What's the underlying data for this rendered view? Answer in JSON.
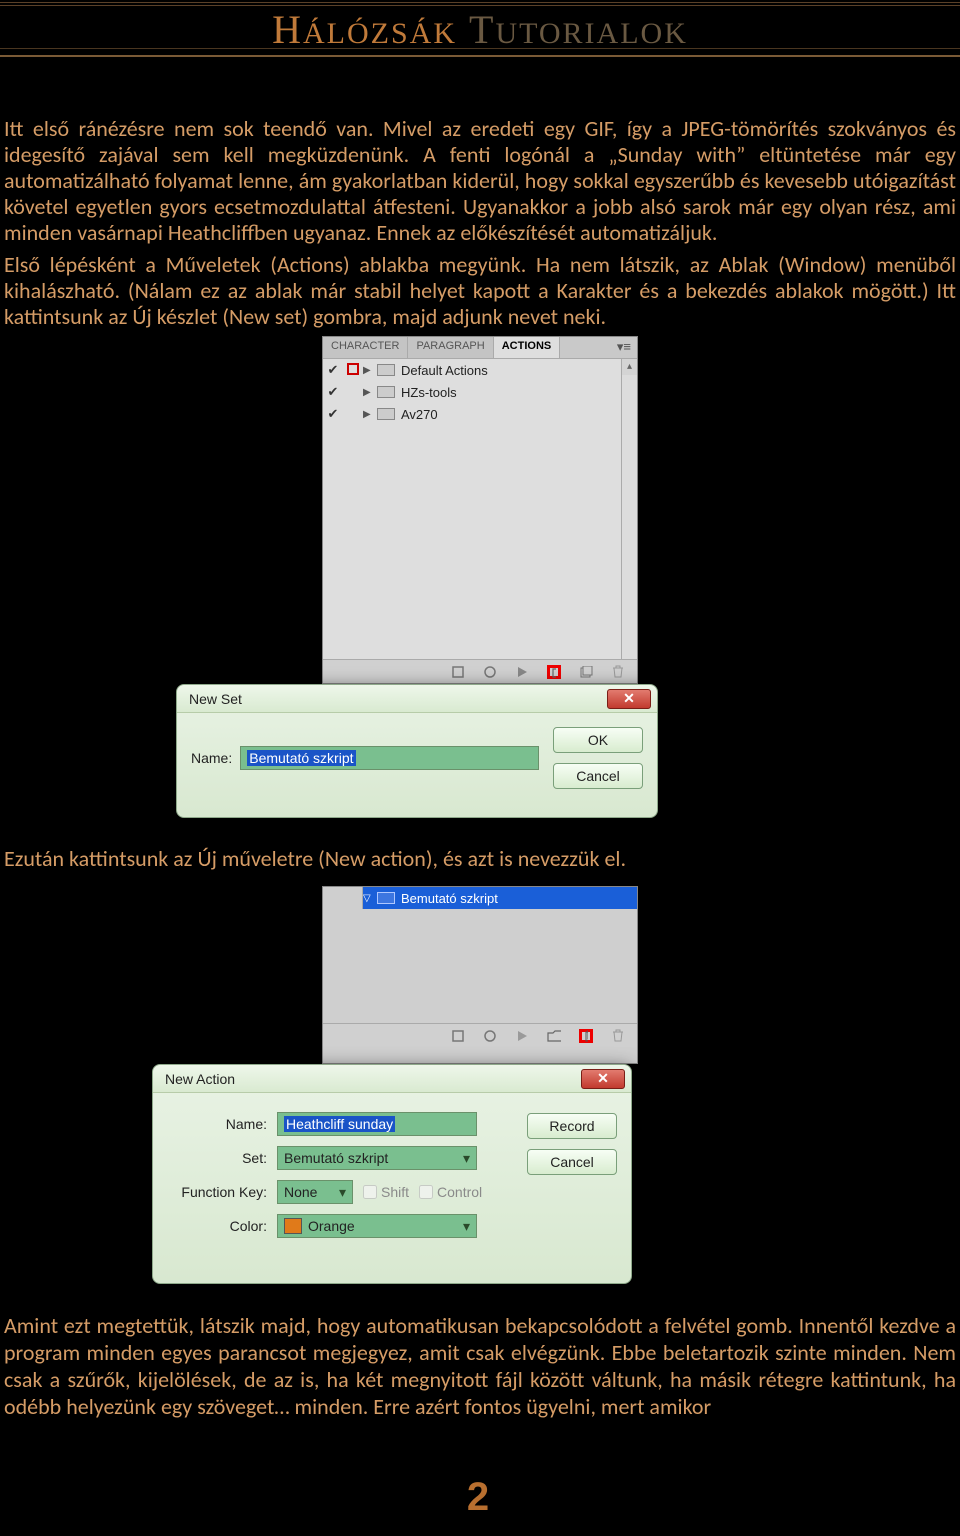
{
  "header": {
    "title_main_cap": "H",
    "title_main_rest": "ÁLÓZSÁK",
    "title_sub_cap": "T",
    "title_sub_rest": "UTORIALOK"
  },
  "paragraphs": {
    "p1": "Itt első ránézésre nem sok teendő van. Mivel az eredeti egy GIF, így a JPEG-tömörítés szokványos és idegesítő zajával sem kell megküzdenünk. A fenti logónál a „Sunday with” eltüntetése már egy automatizálható folyamat lenne, ám gyakorlatban kiderül, hogy sokkal egyszerűbb és kevesebb utóigazítást követel egyetlen gyors ecsetmozdulattal átfesteni. Ugyanakkor a jobb alsó sarok már egy olyan rész, ami minden vasárnapi Heathcliffben ugyanaz. Ennek az előkészítését automatizáljuk.",
    "p2": "Első lépésként a Műveletek (Actions) ablakba megyünk. Ha nem látszik, az Ablak (Window) menüből kihalászható. (Nálam ez az ablak már stabil helyet kapott a Karakter és a bekezdés ablakok mögött.) Itt kattintsunk az Új készlet (New set) gombra, majd adjunk nevet neki.",
    "p3": "Ezután kattintsunk az Új műveletre (New action), és azt is nevezzük el.",
    "p4": "Amint ezt megtettük, látszik majd, hogy automatikusan bekapcsolódott a felvétel gomb. Innentől kezdve a program minden egyes parancsot megjegyez, amit csak elvégzünk. Ebbe beletartozik szinte minden. Nem csak a szűrők, kijelölések, de az is, ha két megnyitott fájl között váltunk, ha másik rétegre kattintunk, ha odébb helyezünk egy szöveget… minden. Erre azért fontos ügyelni, mert amikor"
  },
  "actions_panel": {
    "tabs": [
      "CHARACTER",
      "PARAGRAPH",
      "ACTIONS"
    ],
    "items": [
      {
        "name": "Default Actions"
      },
      {
        "name": "HZs-tools"
      },
      {
        "name": "Av270"
      }
    ]
  },
  "new_set_dialog": {
    "title": "New Set",
    "name_label": "Name:",
    "name_value": "Bemutató szkript",
    "ok": "OK",
    "cancel": "Cancel"
  },
  "panel2": {
    "item": "Bemutató szkript"
  },
  "new_action_dialog": {
    "title": "New Action",
    "name_label": "Name:",
    "name_value": "Heathcliff sunday",
    "set_label": "Set:",
    "set_value": "Bemutató szkript",
    "fkey_label": "Function Key:",
    "fkey_value": "None",
    "shift_label": "Shift",
    "control_label": "Control",
    "color_label": "Color:",
    "color_value": "Orange",
    "record": "Record",
    "cancel": "Cancel"
  },
  "page_number": "2"
}
